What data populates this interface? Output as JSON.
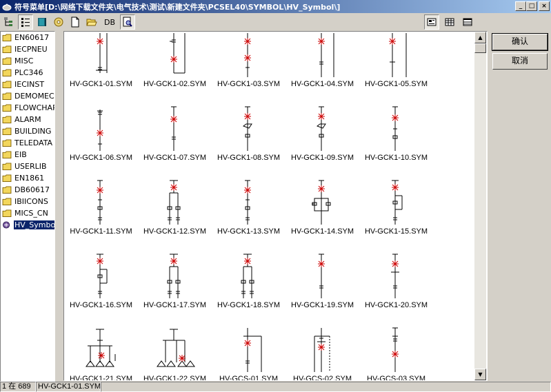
{
  "window": {
    "title": "符号菜单[D:\\网络下载文件夹\\电气技术\\测试\\新建文件夹\\PCSEL40\\SYMBOL\\HV_Symbol\\]",
    "controls": {
      "minimize": "_",
      "maximize": "□",
      "close": "×"
    }
  },
  "toolbar": {
    "db_label": "DB",
    "tools": [
      "tree-view-icon",
      "list-view-icon",
      "book-icon",
      "open-disk-icon",
      "new-file-icon",
      "open-folder-icon",
      "db",
      "preview-icon"
    ],
    "view_modes": [
      "large-icons-view-icon",
      "small-icons-view-icon",
      "details-view-icon"
    ]
  },
  "tree": {
    "items": [
      {
        "label": "EN60617"
      },
      {
        "label": "IECPNEU"
      },
      {
        "label": "MISC"
      },
      {
        "label": "PLC346"
      },
      {
        "label": "IECINST"
      },
      {
        "label": "DEMOMEC"
      },
      {
        "label": "FLOWCHAR"
      },
      {
        "label": "ALARM"
      },
      {
        "label": "BUILDING"
      },
      {
        "label": "TELEDATA"
      },
      {
        "label": "EIB"
      },
      {
        "label": "USERLIB"
      },
      {
        "label": "EN1861"
      },
      {
        "label": "DB60617"
      },
      {
        "label": "IBIICONS"
      },
      {
        "label": "MICS_CN"
      },
      {
        "label": "HV_Symbol",
        "selected": true
      }
    ]
  },
  "symbols": [
    {
      "name": "HV-GCK1-01.SYM",
      "variant": 1
    },
    {
      "name": "HV-GCK1-02.SYM",
      "variant": 2
    },
    {
      "name": "HV-GCK1-03.SYM",
      "variant": 3
    },
    {
      "name": "HV-GCK1-04.SYM",
      "variant": 4
    },
    {
      "name": "HV-GCK1-05.SYM",
      "variant": 5
    },
    {
      "name": "HV-GCK1-06.SYM",
      "variant": 6
    },
    {
      "name": "HV-GCK1-07.SYM",
      "variant": 7
    },
    {
      "name": "HV-GCK1-08.SYM",
      "variant": 8
    },
    {
      "name": "HV-GCK1-09.SYM",
      "variant": 8
    },
    {
      "name": "HV-GCK1-10.SYM",
      "variant": 9
    },
    {
      "name": "HV-GCK1-11.SYM",
      "variant": 10
    },
    {
      "name": "HV-GCK1-12.SYM",
      "variant": 11
    },
    {
      "name": "HV-GCK1-13.SYM",
      "variant": 10
    },
    {
      "name": "HV-GCK1-14.SYM",
      "variant": 12
    },
    {
      "name": "HV-GCK1-15.SYM",
      "variant": 13
    },
    {
      "name": "HV-GCK1-16.SYM",
      "variant": 13
    },
    {
      "name": "HV-GCK1-17.SYM",
      "variant": 11
    },
    {
      "name": "HV-GCK1-18.SYM",
      "variant": 11
    },
    {
      "name": "HV-GCK1-19.SYM",
      "variant": 14
    },
    {
      "name": "HV-GCK1-20.SYM",
      "variant": 15
    },
    {
      "name": "HV-GCK1-21.SYM",
      "variant": 16
    },
    {
      "name": "HV-GCK1-22.SYM",
      "variant": 17
    },
    {
      "name": "HV-GCS-01.SYM",
      "variant": 18
    },
    {
      "name": "HV-GCS-02.SYM",
      "variant": 19
    },
    {
      "name": "HV-GCS-03.SYM",
      "variant": 20
    }
  ],
  "buttons": {
    "ok": "确认",
    "cancel": "取消"
  },
  "status": {
    "position": "1 在 689",
    "selected": "HV-GCK1-01.SYM"
  },
  "colors": {
    "titlebar_start": "#0a246a",
    "titlebar_end": "#a6caf0",
    "selection": "#0a246a",
    "symbol_accent": "#cc0000",
    "folder": "#f2d65c"
  }
}
